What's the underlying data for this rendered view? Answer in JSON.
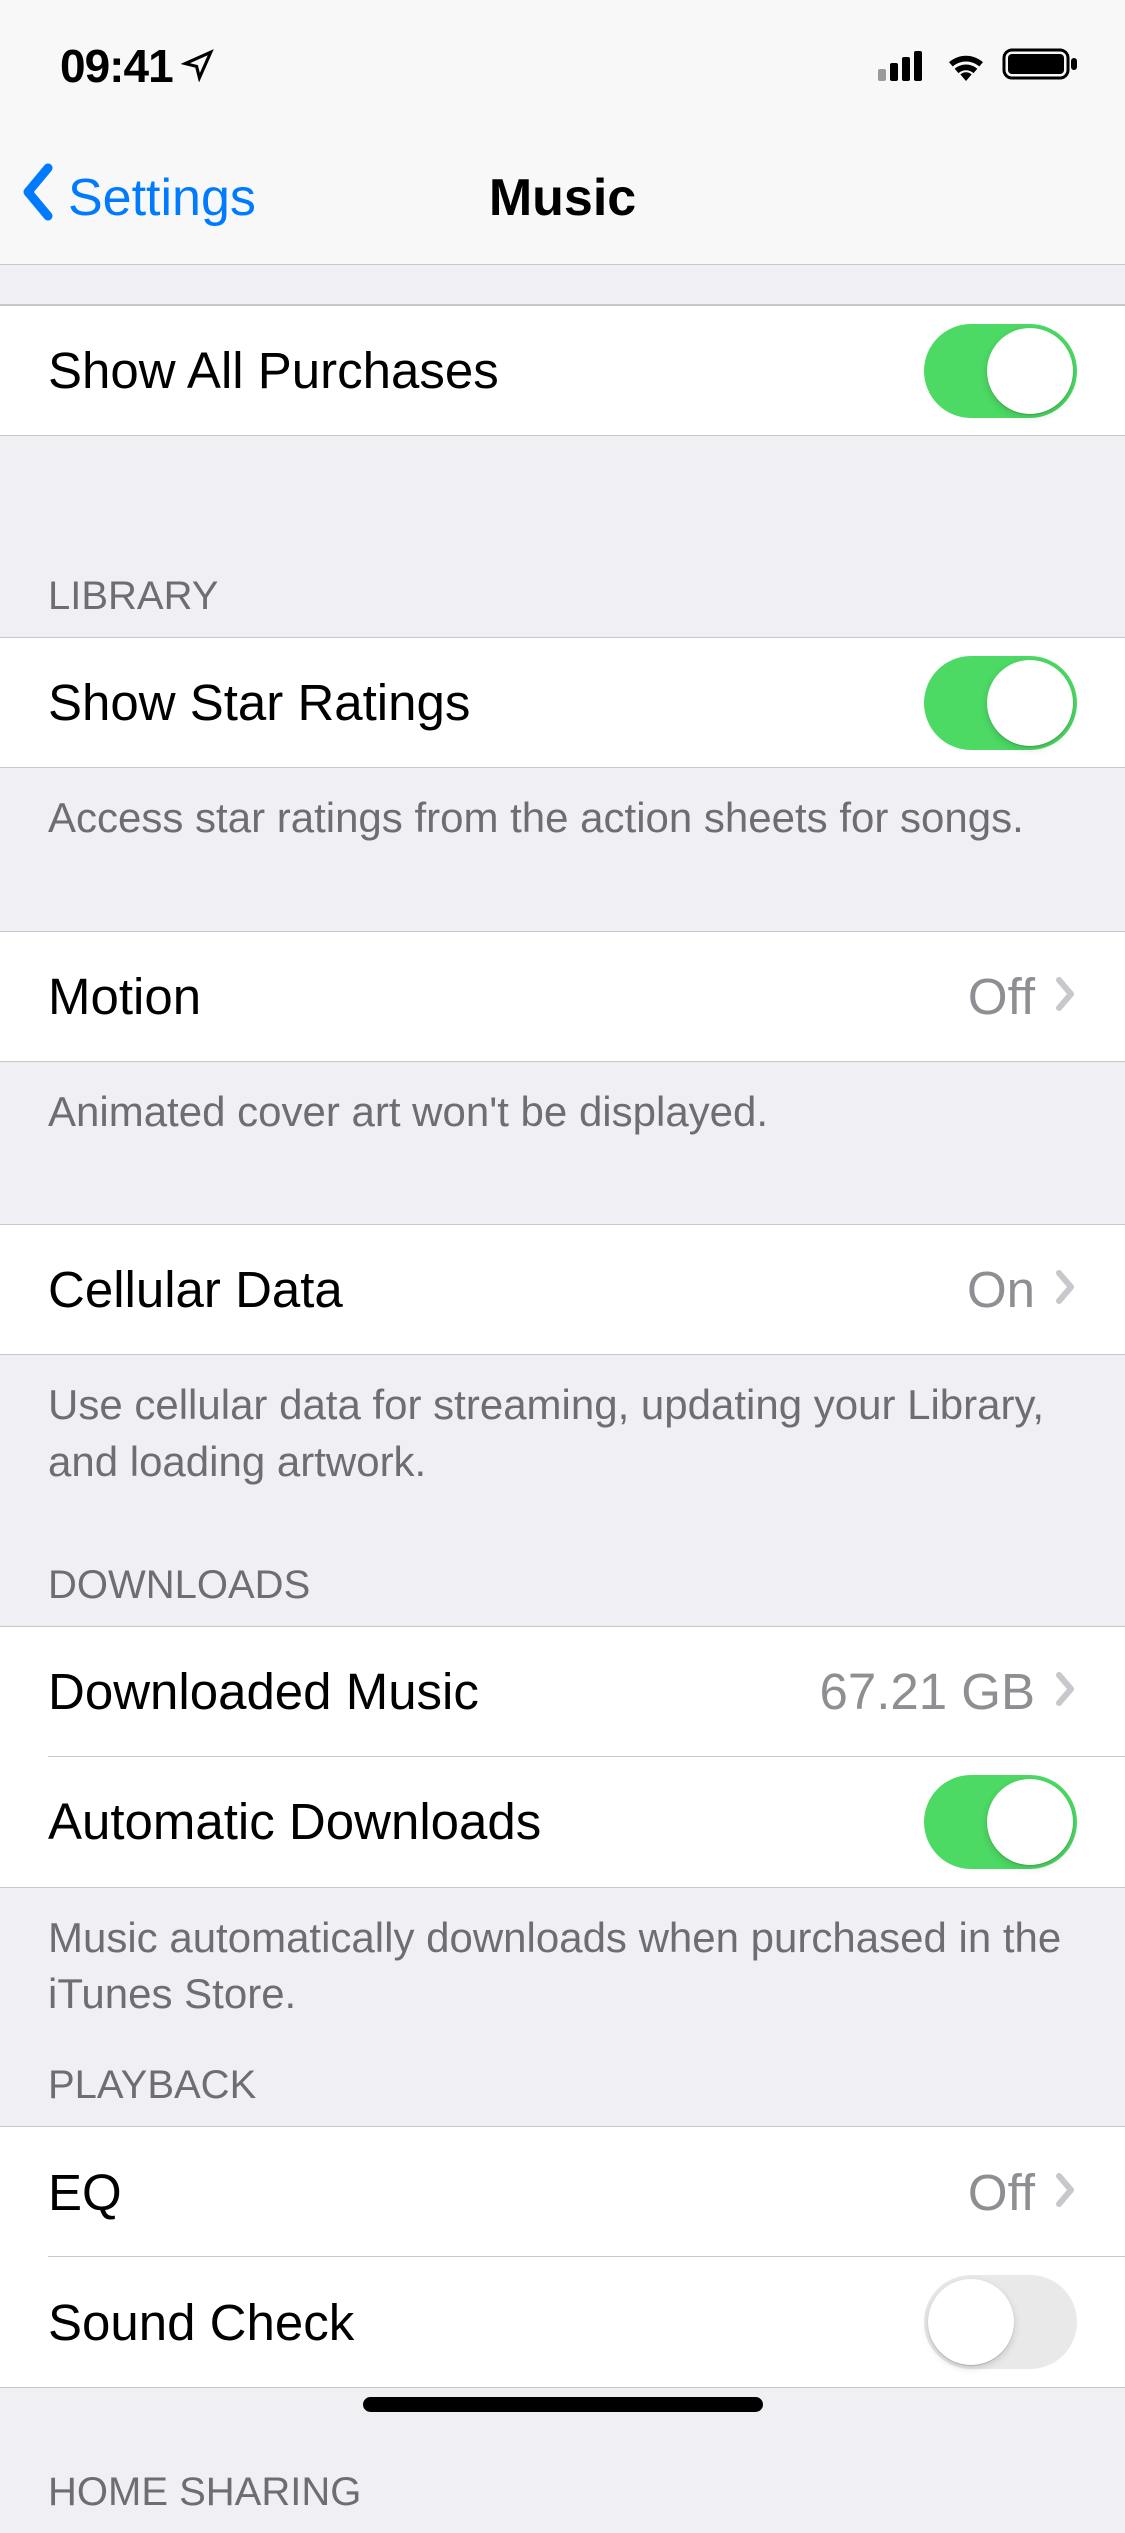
{
  "status": {
    "time": "09:41"
  },
  "nav": {
    "back": "Settings",
    "title": "Music"
  },
  "sections": {
    "top": {
      "items": [
        {
          "label": "Show All Purchases",
          "toggle": true
        }
      ]
    },
    "library": {
      "header": "LIBRARY",
      "starRatings": {
        "label": "Show Star Ratings",
        "toggle": true,
        "footer": "Access star ratings from the action sheets for songs."
      },
      "motion": {
        "label": "Motion",
        "value": "Off",
        "footer": "Animated cover art won't be displayed."
      },
      "cellular": {
        "label": "Cellular Data",
        "value": "On",
        "footer": "Use cellular data for streaming, updating your Library, and loading artwork."
      }
    },
    "downloads": {
      "header": "DOWNLOADS",
      "downloaded": {
        "label": "Downloaded Music",
        "value": "67.21 GB"
      },
      "automatic": {
        "label": "Automatic Downloads",
        "toggle": true,
        "footer": "Music automatically downloads when purchased in the iTunes Store."
      }
    },
    "playback": {
      "header": "PLAYBACK",
      "eq": {
        "label": "EQ",
        "value": "Off"
      },
      "soundcheck": {
        "label": "Sound Check",
        "toggle": false
      }
    },
    "homeSharing": {
      "header": "HOME SHARING"
    }
  }
}
